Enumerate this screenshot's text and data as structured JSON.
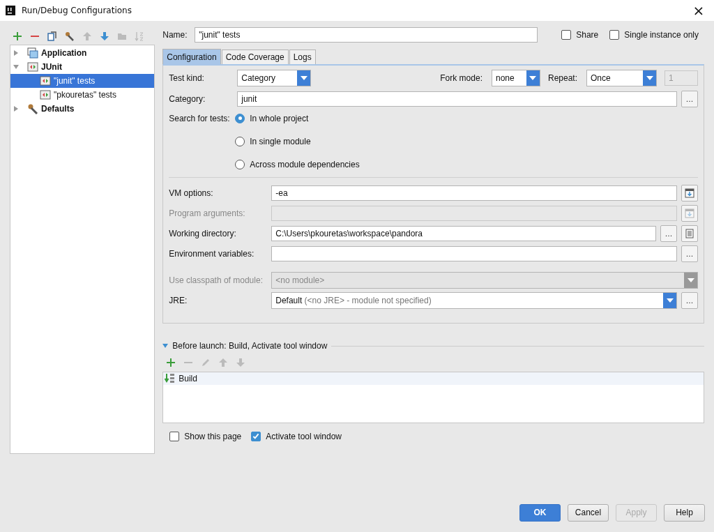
{
  "window": {
    "title": "Run/Debug Configurations",
    "close": "×"
  },
  "tree": [
    {
      "label": "Application",
      "expanded": false,
      "selected": false
    },
    {
      "label": "JUnit",
      "expanded": true,
      "selected": false,
      "children": [
        {
          "label": "\"junit\" tests",
          "selected": true
        },
        {
          "label": "\"pkouretas\" tests",
          "selected": false
        }
      ]
    },
    {
      "label": "Defaults",
      "expanded": false,
      "selected": false
    }
  ],
  "name": {
    "label": "Name:",
    "value": "\"junit\" tests"
  },
  "share": {
    "label": "Share",
    "checked": false
  },
  "single_instance": {
    "label": "Single instance only",
    "checked": false
  },
  "tabs": [
    {
      "label": "Configuration",
      "selected": true
    },
    {
      "label": "Code Coverage",
      "selected": false
    },
    {
      "label": "Logs",
      "selected": false
    }
  ],
  "test_kind": {
    "label": "Test kind:",
    "value": "Category"
  },
  "fork_mode": {
    "label": "Fork mode:",
    "value": "none"
  },
  "repeat": {
    "label": "Repeat:",
    "value": "Once",
    "count": "1"
  },
  "category": {
    "label": "Category:",
    "value": "junit",
    "browse": "..."
  },
  "search_for_tests": {
    "label": "Search for tests:",
    "options": [
      {
        "label": "In whole project",
        "selected": true
      },
      {
        "label": "In single module",
        "selected": false
      },
      {
        "label": "Across module dependencies",
        "selected": false
      }
    ]
  },
  "fields": [
    {
      "label": "VM options:",
      "value": "-ea",
      "disabled": false,
      "kind": "expand"
    },
    {
      "label": "Program arguments:",
      "disabled": true,
      "kind": "expand"
    },
    {
      "label": "Working directory:",
      "value": "C:\\Users\\pkouretas\\workspace\\pandora",
      "disabled": false,
      "kind": "browse-macro",
      "browse": "..."
    },
    {
      "label": "Environment variables:",
      "disabled": false,
      "kind": "browse",
      "browse": "..."
    }
  ],
  "classpath": {
    "label": "Use classpath of module:",
    "value": "<no module>",
    "disabled": true
  },
  "jre": {
    "label": "JRE:",
    "value": "Default",
    "hint": "(<no JRE> - module not specified)",
    "browse": "..."
  },
  "before_launch": {
    "title": "Before launch: Build, Activate tool window",
    "expanded": true,
    "items": [
      {
        "label": "Build",
        "selected": false
      }
    ]
  },
  "show_this_page": {
    "label": "Show this page",
    "checked": false
  },
  "activate_tool_window": {
    "label": "Activate tool window",
    "checked": true
  },
  "buttons": [
    {
      "label": "OK",
      "kind": "primary"
    },
    {
      "label": "Cancel",
      "kind": "normal"
    },
    {
      "label": "Apply",
      "kind": "disabled"
    },
    {
      "label": "Help",
      "kind": "normal"
    }
  ]
}
